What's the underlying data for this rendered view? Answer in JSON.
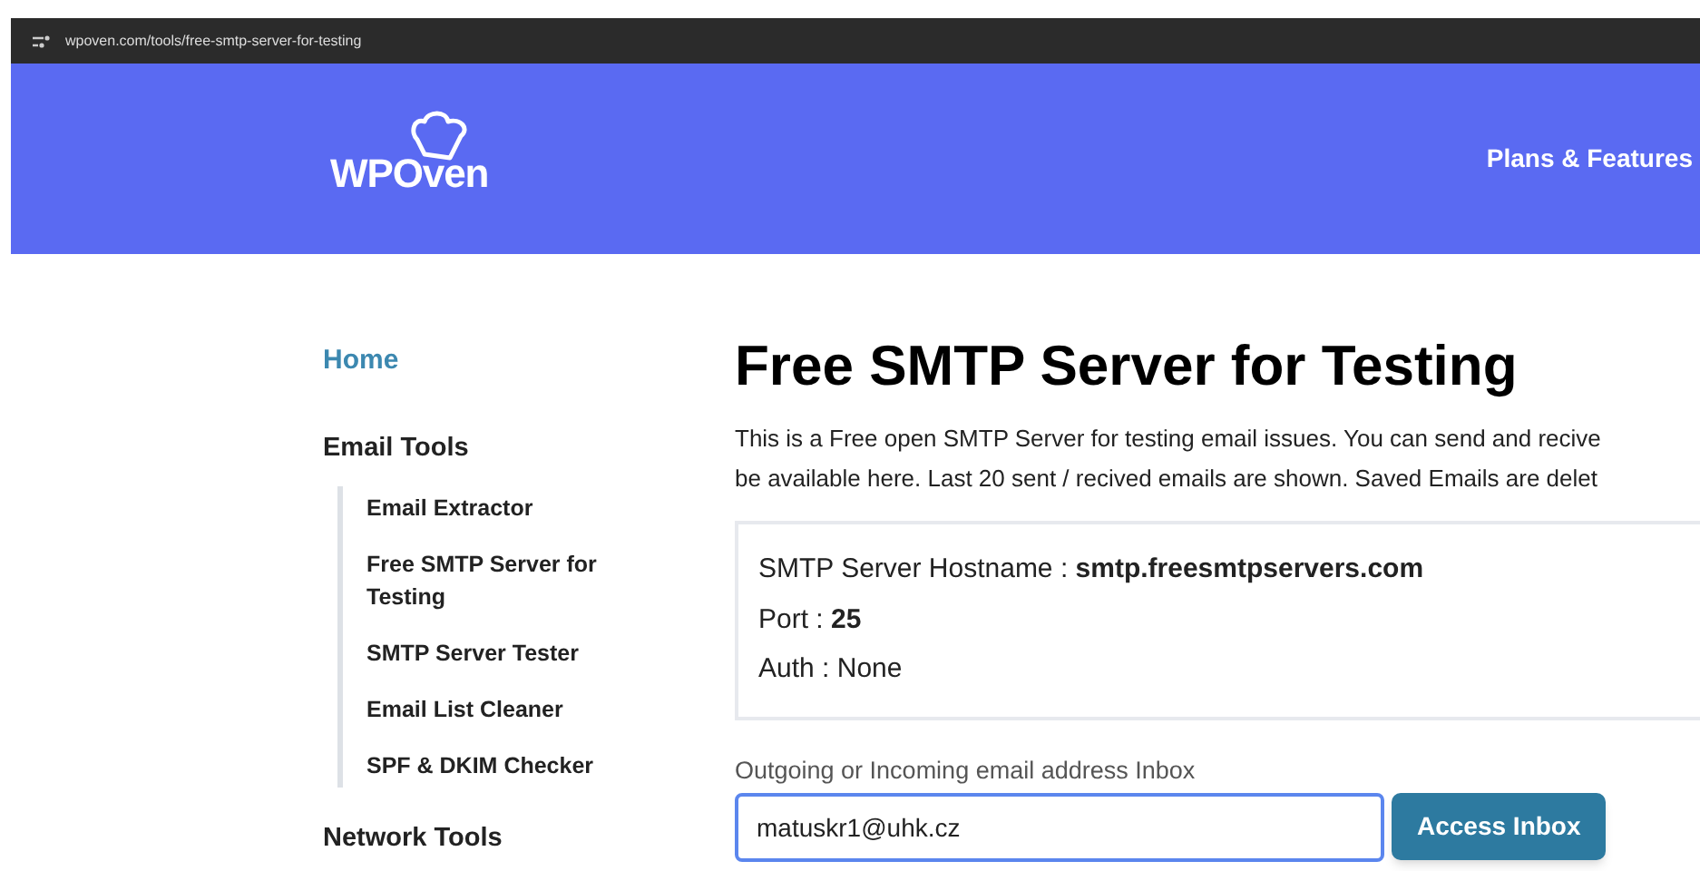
{
  "address_bar": {
    "url": "wpoven.com/tools/free-smtp-server-for-testing"
  },
  "header": {
    "logo": "WPOven",
    "nav": [
      "Plans & Features"
    ]
  },
  "sidebar": {
    "home": "Home",
    "sections": [
      {
        "title": "Email Tools",
        "items": [
          "Email Extractor",
          "Free SMTP Server for Testing",
          "SMTP Server Tester",
          "Email List Cleaner",
          "SPF & DKIM Checker"
        ]
      },
      {
        "title": "Network Tools"
      }
    ]
  },
  "main": {
    "title": "Free SMTP Server for Testing",
    "description": [
      "This is a Free open SMTP Server for testing email issues. You can send and recive",
      "be available here. Last 20 sent / recived emails are shown. Saved Emails are delet"
    ],
    "info": [
      "SMTP Server Hostname : **smtp.freesmtpservers.com**",
      "Port : **25**",
      "Auth : None"
    ],
    "inbox_label": "Outgoing or Incoming email address Inbox",
    "inbox_value": "matuskr1@uhk.cz",
    "button": "Access Inbox"
  }
}
